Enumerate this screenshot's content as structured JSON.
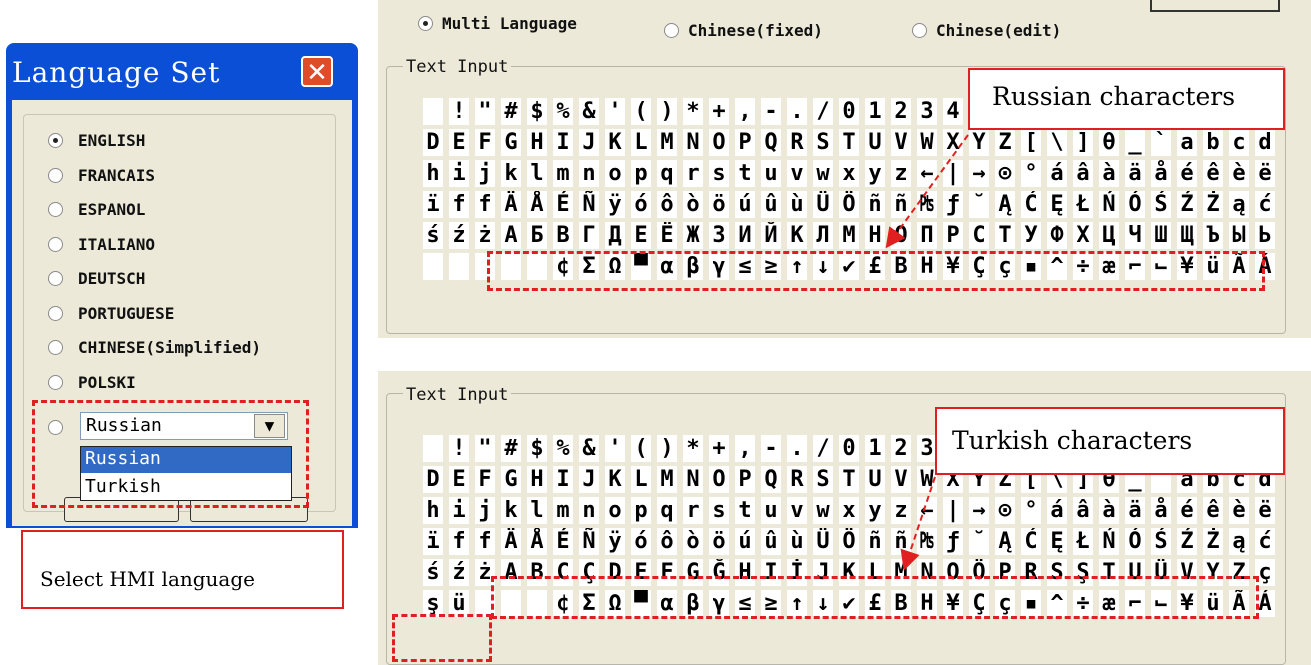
{
  "dialog": {
    "title": "Language Set",
    "close_glyph": "✕",
    "options": [
      "ENGLISH",
      "FRANCAIS",
      "ESPANOL",
      "ITALIANO",
      "DEUTSCH",
      "PORTUGUESE",
      "CHINESE(Simplified)",
      "POLSKI"
    ],
    "selected_option": "ENGLISH",
    "combo_value": "Russian",
    "dropdown_options": [
      "Russian",
      "Turkish"
    ],
    "dropdown_highlight": "Russian"
  },
  "top_panel": {
    "modes": [
      "Multi Language",
      "Chinese(fixed)",
      "Chinese(edit)"
    ],
    "selected_mode": "Multi Language",
    "group_label": "Text Input",
    "rows": [
      " !\"#$%&'()*+,-./0123456",
      "DEFGHIJKLMNOPQRSTUVWXYZ[\\]θ_`abcdefg",
      "hijklmnopqrstuvwxyz←|→⊙°áâàäåéêèëíîì",
      "ïffÄÅÉÑÿóôòöúûùÜÖññ₧ƒ˘ĄĆĘŁŃÓŚŹŻąćęłńó",
      "śźżАБВГДЕЁЖЗИЙКЛМНОПРСТУФХЦЧШЩЪЫЬЭЮЯ",
      "     ¢ΣΩ▀αβγ≤≥↑↓✔£ΒΗ¥Çç▪^÷æ⌐⌙¥üÃÁÂÈ"
    ]
  },
  "bottom_panel": {
    "group_label": "Text Input",
    "rows": [
      " !\"#$%&'()*+,-./012345",
      "DEFGHIJKLMNOPQRSTUVWXYZ[\\]θ_`abcdefg",
      "hijklmnopqrstuvwxyz←|→⊙°áâàäåéêèëíîì",
      "ïffÄÅÉÑÿóôòöúûùÜÖññ₧ƒ˘ĄĆĘŁŃÓŚŹŻąćęłńó",
      "śźżABCÇDEFGĞHIİJKLMNOÖPRSŞTUÜVYZçğıö",
      "şü   ¢ΣΩ▀αβγ≤≥↑↓✔£ΒΗ¥Çç▪^÷æ⌐⌙¥üÃÁÂÈ"
    ]
  },
  "callouts": {
    "russian": "Russian characters",
    "turkish": "Turkish characters",
    "select": "Select HMI language"
  }
}
